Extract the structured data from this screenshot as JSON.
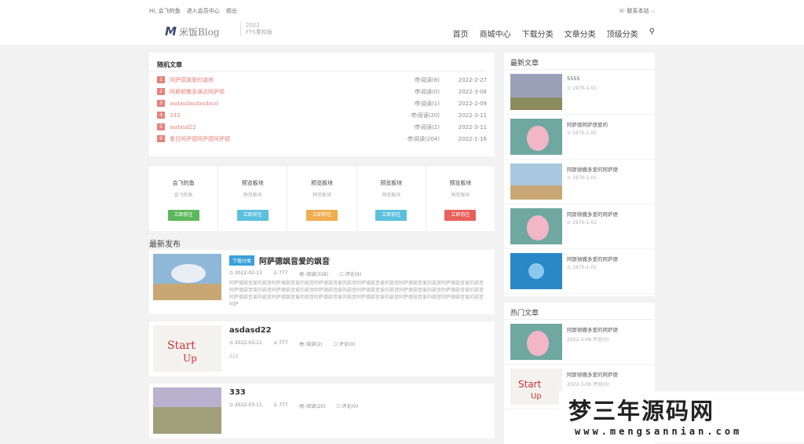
{
  "topbar": {
    "greeting": "Hi, 会飞的鱼",
    "member": "进入会员中心",
    "logout": "退出",
    "contact": "☏ 联系本站 ⌵"
  },
  "logo": {
    "mark": "M",
    "text": "米饭Blog",
    "sub1": "2022",
    "sub2": "FYS重构版"
  },
  "nav": [
    "首页",
    "商城中心",
    "下载分类",
    "文章分类",
    "顶级分类",
    "⚲"
  ],
  "random": {
    "title": "随机文章",
    "items": [
      {
        "n": "1",
        "t": "阿萨德飒爱的飒爸",
        "r": "👁阅读(8)",
        "d": "2022-2-27"
      },
      {
        "n": "2",
        "t": "阿斯顿撒多飒达阿萨德",
        "r": "👁阅读(0)",
        "d": "2022-3-08"
      },
      {
        "n": "3",
        "t": "asdasdasdasdasd",
        "r": "👁阅读(1)",
        "d": "2022-2-09"
      },
      {
        "n": "4",
        "t": "333",
        "r": "👁阅读(20)",
        "d": "2022-3-11"
      },
      {
        "n": "5",
        "t": "asdasd22",
        "r": "👁阅读(2)",
        "d": "2022-3-11"
      },
      {
        "n": "6",
        "t": "看日阿萨德阿萨德阿萨德",
        "r": "👁阅读(204)",
        "d": "2022-1-16"
      }
    ]
  },
  "blocks": [
    {
      "a": "会飞的鱼",
      "b": "会飞的鱼",
      "btn": "立即前往",
      "c": "#5cb85c"
    },
    {
      "a": "预览板块",
      "b": "预览板块",
      "btn": "立即前往",
      "c": "#5bc0de"
    },
    {
      "a": "预览板块",
      "b": "预览板块",
      "btn": "立即前往",
      "c": "#f0ad4e"
    },
    {
      "a": "预览板块",
      "b": "预览板块",
      "btn": "立即前往",
      "c": "#5bc0de"
    },
    {
      "a": "预览板块",
      "b": "预览板块",
      "btn": "立即前往",
      "c": "#e9605a"
    }
  ],
  "section": "最新发布",
  "posts": [
    {
      "tag": "下载分类",
      "title": "阿萨德飒音爱的飒音",
      "date": "2022-02-13",
      "au": "777",
      "rd": "阅读(328)",
      "cm": "评论(9)",
      "exc": "阿萨德飒音爱的飒音阿萨德飒音爱的飒音阿萨德飒音爱的飒音阿萨德飒音爱的飒音阿萨德飒音爱的飒音阿萨德飒音爱的飒音阿萨德飒音爱的飒音阿萨德飒音爱的飒音阿萨德飒音爱的飒音阿萨德飒音爱的飒音阿萨德飒音爱的飒音阿萨德飒音爱的飒音阿萨德飒音爱的飒音阿萨德飒音爱的飒音阿萨德飒音爱的飒音阿萨德飒音爱的飒音阿萨德飒音爱的飒音阿萨德飒音爱的飒音阿萨"
    },
    {
      "tag": "",
      "title": "asdasd22",
      "date": "2022-03-11",
      "au": "777",
      "rd": "阅读(2)",
      "cm": "评论(0)",
      "exc": "222"
    },
    {
      "tag": "",
      "title": "333",
      "date": "2022-03-11",
      "au": "777",
      "rd": "阅读(20)",
      "cm": "评论(0)",
      "exc": ""
    }
  ],
  "latest": {
    "title": "最新文章",
    "items": [
      {
        "t": "5555",
        "d": "1970-1-01"
      },
      {
        "t": "阿萨德阿萨德爱的",
        "d": "1970-1-01"
      },
      {
        "t": "阿斯顿撒多爱的阿萨德",
        "d": "1970-1-01"
      },
      {
        "t": "阿斯顿撒多爱的阿萨德",
        "d": "1970-1-01"
      },
      {
        "t": "阿斯顿撒多爱的阿萨德",
        "d": "1970-1-01"
      }
    ]
  },
  "hot": {
    "title": "热门文章",
    "items": [
      {
        "t": "阿斯顿撒多爱的阿萨德",
        "d": "2022-3-08    评论(0)"
      },
      {
        "t": "阿斯顿撒多爱的阿萨德",
        "d": "2022-3-08    评论(0)"
      }
    ]
  },
  "watermark": {
    "big": "梦三年源码网",
    "url": "www.mengsannian.com"
  }
}
